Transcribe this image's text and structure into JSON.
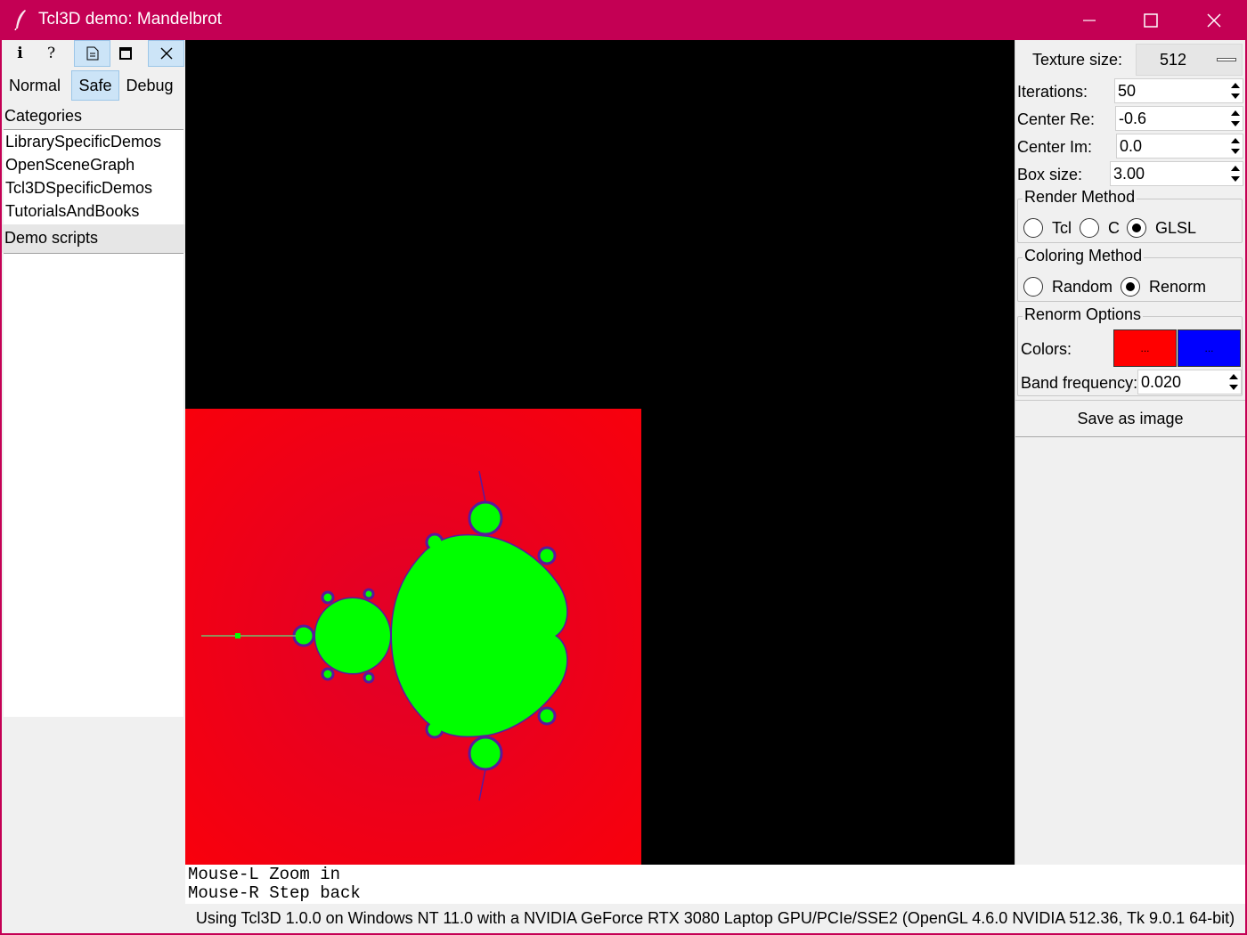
{
  "window": {
    "title": "Tcl3D demo: Mandelbrot",
    "titlebar_color": "#c40054"
  },
  "toolbar": {
    "buttons": [
      {
        "icon": "info-icon",
        "glyph": "i"
      },
      {
        "icon": "help-icon",
        "glyph": "?"
      },
      {
        "icon": "document-icon",
        "glyph": ""
      },
      {
        "icon": "fullscreen-icon",
        "glyph": ""
      },
      {
        "icon": "close-icon",
        "glyph": "✕"
      }
    ]
  },
  "modes": {
    "normal": "Normal",
    "safe": "Safe",
    "debug": "Debug",
    "selected": "Safe"
  },
  "categories": {
    "label": "Categories",
    "items": [
      "LibrarySpecificDemos",
      "OpenSceneGraph",
      "Tcl3DSpecificDemos",
      "TutorialsAndBooks"
    ]
  },
  "demo_scripts": {
    "label": "Demo scripts"
  },
  "settings": {
    "texture_size_label": "Texture size:",
    "texture_size_value": "512",
    "iterations_label": "Iterations:",
    "iterations_value": "50",
    "center_re_label": "Center Re:",
    "center_re_value": "-0.6",
    "center_im_label": "Center Im:",
    "center_im_value": "0.0",
    "box_size_label": "Box size:",
    "box_size_value": "3.00"
  },
  "render_method": {
    "label": "Render Method",
    "options": [
      "Tcl",
      "C",
      "GLSL"
    ],
    "selected": "GLSL"
  },
  "coloring_method": {
    "label": "Coloring Method",
    "options": [
      "Random",
      "Renorm"
    ],
    "selected": "Renorm"
  },
  "renorm_options": {
    "label": "Renorm Options",
    "colors_label": "Colors:",
    "color1": "#ff0000",
    "color2": "#0000ff",
    "swatch_text": "...",
    "band_frequency_label": "Band frequency:",
    "band_frequency_value": "0.020"
  },
  "save_button": "Save as image",
  "info_lines": [
    "Mouse-L Zoom in",
    "Mouse-R Step back"
  ],
  "status": "Using Tcl3D 1.0.0 on Windows NT 11.0 with a NVIDIA GeForce RTX 3080 Laptop GPU/PCIe/SSE2 (OpenGL 4.6.0 NVIDIA 512.36, Tk 9.0.1 64-bit)"
}
